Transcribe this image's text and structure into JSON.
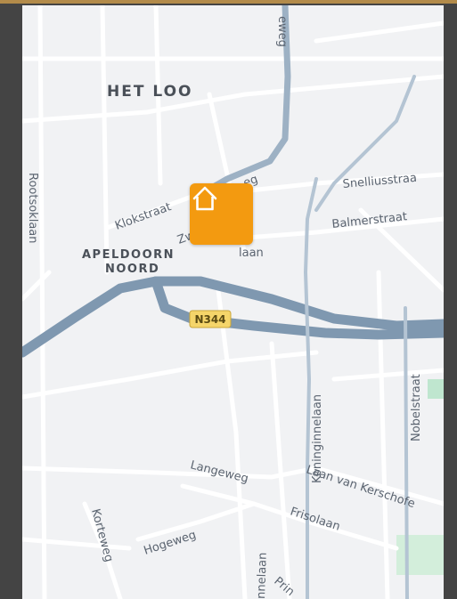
{
  "colors": {
    "frame": "#444444",
    "accent": "#b38b4a",
    "map_background": "#f1f2f4",
    "major_road": "#7f98b0",
    "minor_road": "#ffffff",
    "pin": "#f39a10",
    "shield": "#f5d56a",
    "park": "#bfe6cf"
  },
  "map": {
    "districts": {
      "het_loo": "HET LOO",
      "apeldoorn_line1": "APELDOORN",
      "apeldoorn_line2": "NOORD"
    },
    "road_shield": "N344",
    "street_labels": {
      "zw_top": "eweg",
      "rootsoklaan": "Rootsoklaan",
      "klokstraat": "Klokstraat",
      "zw_fragment": "Zw",
      "eg_fragment": "eg",
      "laan_fragment": "laan",
      "snelliusstraat": "Snelliusstraa",
      "balmerstraat": "Balmerstraat",
      "nobelstraat": "Nobelstraat",
      "koninginnelaan": "Koninginnelaan",
      "laan_van_kerschoften": "Laan van Kerschofe",
      "langeweg": "Langeweg",
      "frisolaan": "Frisolaan",
      "hogeweg": "Hogeweg",
      "korteweg": "Korteweg",
      "nnelaan": "nnelaan",
      "prins": "Prin"
    },
    "marker": {
      "icon": "home-icon",
      "label": "home"
    }
  }
}
